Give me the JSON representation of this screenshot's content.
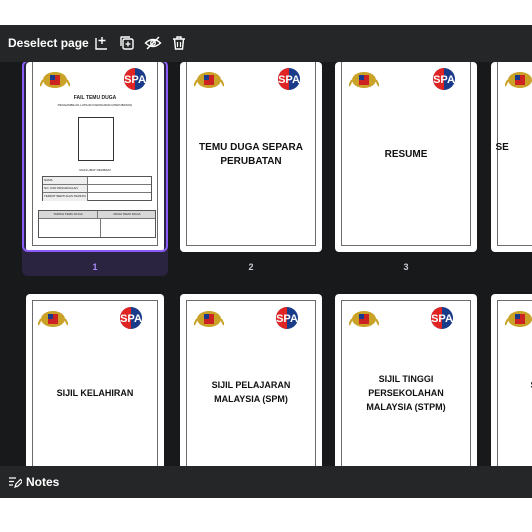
{
  "toolbar": {
    "deselect_label": "Deselect page",
    "icons": [
      "add-page-icon",
      "duplicate-page-icon",
      "hide-page-icon",
      "delete-page-icon"
    ]
  },
  "pages": [
    {
      "number": "1",
      "selected": true,
      "cover": {
        "title": "FAIL TEMU DUGA",
        "subtitle": "PENGAMBILAN LATIHAN KEPAKARAN (PERUBATAN)",
        "section": "MAKLUMAT PERIBADI",
        "rows": [
          "NAMA",
          "NO. KAD PENGENALAN",
          "TEMPAT BERTUGAS TERKINI"
        ],
        "footer_cols": [
          "TARIKH TEMU DUGA",
          "MASA TEMU DUGA"
        ]
      }
    },
    {
      "number": "2",
      "title": "TEMU DUGA SEPARA PERUBATAN"
    },
    {
      "number": "3",
      "title": "RESUME"
    },
    {
      "number": "",
      "title": "SE DOKU"
    },
    {
      "number": "",
      "title": "SIJIL KELAHIRAN"
    },
    {
      "number": "",
      "title": "SIJIL PELAJARAN MALAYSIA (SPM)"
    },
    {
      "number": "",
      "title": "SIJIL TINGGI PERSEKOLAHAN MALAYSIA (STPM)"
    },
    {
      "number": "",
      "title": "SI D"
    }
  ],
  "footer": {
    "notes_label": "Notes"
  },
  "colors": {
    "bar_bg": "#252627",
    "canvas_bg": "#18191b",
    "selection": "#8b5cf6",
    "page_number": "#c9c9d1"
  }
}
